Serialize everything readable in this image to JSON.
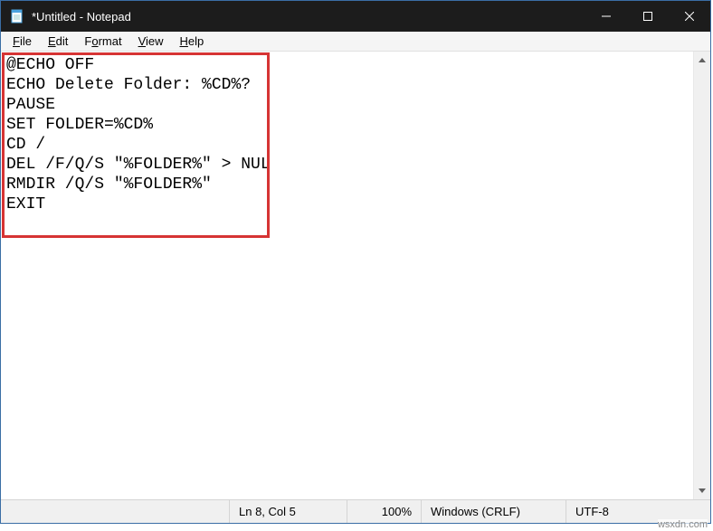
{
  "titlebar": {
    "title": "*Untitled - Notepad"
  },
  "menubar": {
    "items": [
      {
        "pre": "",
        "ul": "F",
        "post": "ile"
      },
      {
        "pre": "",
        "ul": "E",
        "post": "dit"
      },
      {
        "pre": "F",
        "ul": "o",
        "post": "rmat"
      },
      {
        "pre": "",
        "ul": "V",
        "post": "iew"
      },
      {
        "pre": "",
        "ul": "H",
        "post": "elp"
      }
    ]
  },
  "editor": {
    "content": "@ECHO OFF\nECHO Delete Folder: %CD%?\nPAUSE\nSET FOLDER=%CD%\nCD /\nDEL /F/Q/S \"%FOLDER%\" > NUL\nRMDIR /Q/S \"%FOLDER%\"\nEXIT"
  },
  "statusbar": {
    "position": "Ln 8, Col 5",
    "zoom": "100%",
    "eol": "Windows (CRLF)",
    "encoding": "UTF-8"
  },
  "watermark": "wsxdn.com"
}
